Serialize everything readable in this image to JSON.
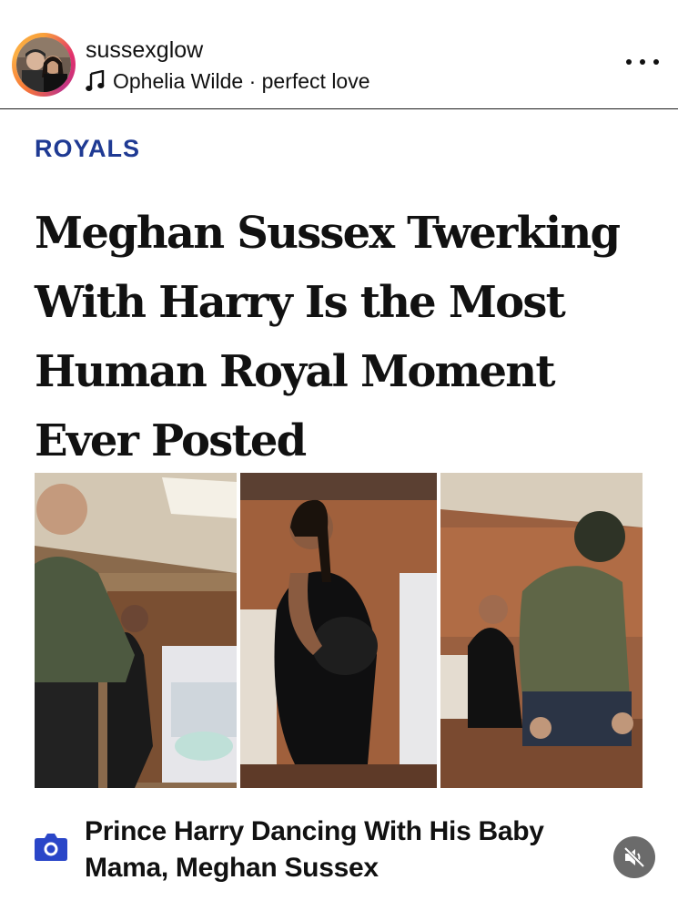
{
  "post": {
    "username": "sussexglow",
    "audio_icon": "music-note-icon",
    "audio_label": "Ophelia Wilde · perfect love",
    "more_icon": "more-options-icon"
  },
  "article": {
    "category": "ROYALS",
    "headline": "Meghan Sussex Twerking With Harry Is the Most Human Royal Moment Ever Posted",
    "caption_icon": "camera-icon",
    "caption": "Prince Harry Dancing With His Baby Mama, Meghan Sussex",
    "mute_icon": "muted-speaker-icon"
  },
  "colors": {
    "category": "#1f3a93",
    "camera_icon": "#2a46c8",
    "mute_button": "#6b6b6b"
  }
}
